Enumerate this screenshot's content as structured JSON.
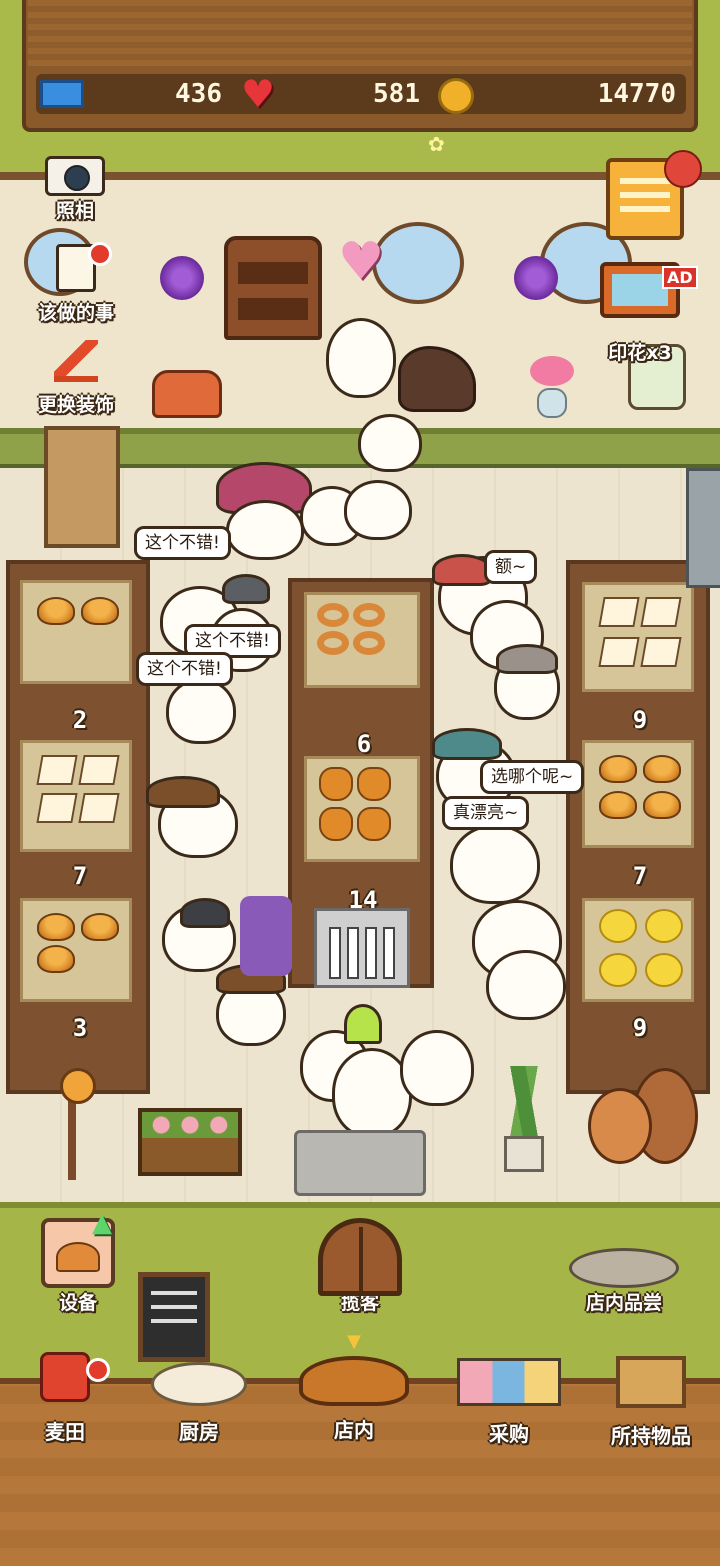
{
  "stats": {
    "tickets": "436",
    "hearts": "581",
    "coins": "14770"
  },
  "side_menu": {
    "photo_label": "照相",
    "todo_label": "该做的事",
    "decor_label": "更换装饰",
    "stamp_label": "印花x3",
    "ad_badge": "AD"
  },
  "speech": {
    "b1": "这个不错!",
    "b2": "这个不错!",
    "b3": "这个不错!",
    "b4": "额~",
    "b5": "选哪个呢~",
    "b6": "真漂亮~"
  },
  "shelves": {
    "left_mid_price": "2",
    "left_lower_price": "7",
    "left_bottom_price": "3",
    "center_top_price": "6",
    "center_bottom_price": "14",
    "right_mid_price": "9",
    "right_lower_price": "7",
    "right_bottom_price": "9"
  },
  "actions": {
    "equipment_label": "设备",
    "attract_label": "揽客",
    "tasting_label": "店内品尝"
  },
  "bottom_nav": {
    "wheat_field": "麦田",
    "kitchen": "厨房",
    "shop": "店内",
    "purchase": "采购",
    "inventory": "所持物品"
  },
  "colors": {
    "wood": "#8b5a2b",
    "grass": "#a9b94a",
    "floor": "#ede4cf",
    "alert_red": "#e23b2c"
  }
}
